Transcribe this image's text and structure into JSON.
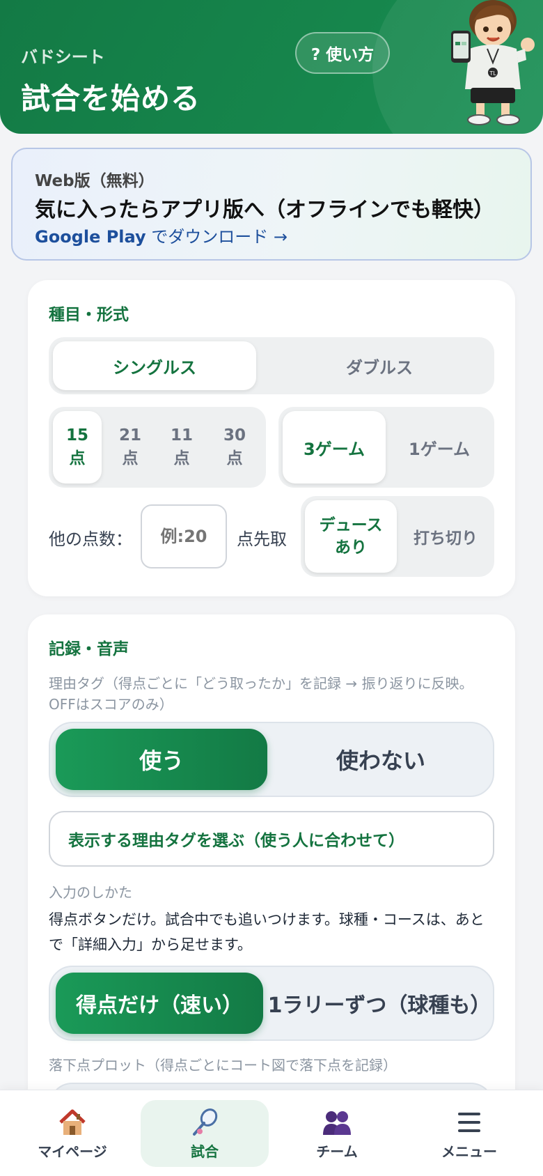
{
  "header": {
    "app_name": "バドシート",
    "title": "試合を始める",
    "help_button": "? 使い方"
  },
  "promo": {
    "sub": "Web版（無料）",
    "headline": "気に入ったらアプリ版へ（オフラインでも軽快）",
    "link_strong": "Google Play",
    "link_rest": " でダウンロード →"
  },
  "format": {
    "title": "種目・形式",
    "event_options": [
      "シングルス",
      "ダブルス"
    ],
    "event_selected": "シングルス",
    "points_options": [
      {
        "num": "15",
        "unit": "点"
      },
      {
        "num": "21",
        "unit": "点"
      },
      {
        "num": "11",
        "unit": "点"
      },
      {
        "num": "30",
        "unit": "点"
      }
    ],
    "points_selected": "15",
    "games_options": [
      "3ゲーム",
      "1ゲーム"
    ],
    "games_selected": "3ゲーム",
    "other_label": "他の点数：",
    "other_placeholder": "例:20",
    "other_suffix": "点先取",
    "deuce_options": [
      "デュースあり",
      "打ち切り"
    ],
    "deuce_selected": "デュースあり"
  },
  "record": {
    "title": "記録・音声",
    "reason_hint": "理由タグ（得点ごとに「どう取ったか」を記録 → 振り返りに反映。OFFはスコアのみ）",
    "reason_options": [
      "使う",
      "使わない"
    ],
    "reason_selected": "使う",
    "choose_tags_button": "表示する理由タグを選ぶ（使う人に合わせて）",
    "input_mode_label": "入力のしかた",
    "input_mode_desc": "得点ボタンだけ。試合中でも追いつけます。球種・コースは、あとで「詳細入力」から足せます。",
    "input_options": [
      "得点だけ（速い）",
      "1ラリーずつ（球種も）"
    ],
    "input_selected": "得点だけ（速い）",
    "drop_plot_hint": "落下点プロット（得点ごとにコート図で落下点を記録）"
  },
  "nav": {
    "items": [
      {
        "label": "マイページ",
        "icon": "house-icon"
      },
      {
        "label": "試合",
        "icon": "racket-icon"
      },
      {
        "label": "チーム",
        "icon": "team-icon"
      },
      {
        "label": "メニュー",
        "icon": "menu-icon"
      }
    ],
    "active": "試合"
  },
  "colors": {
    "brand_green": "#137a45",
    "promo_link": "#1d4f9c"
  }
}
